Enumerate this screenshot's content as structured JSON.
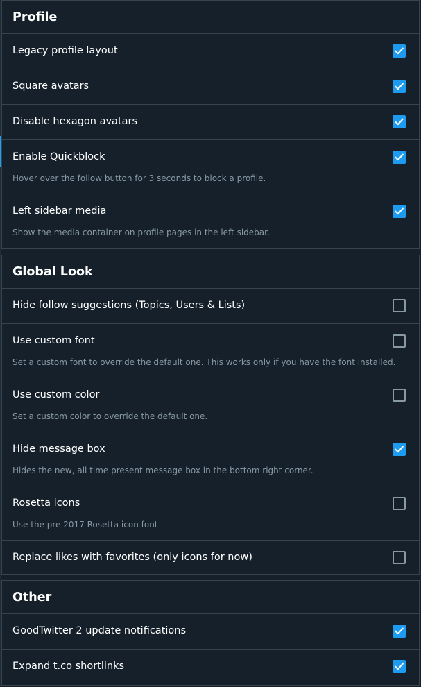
{
  "accent_color": "#1d9bf0",
  "sections": {
    "profile": {
      "title": "Profile",
      "items": [
        {
          "label": "Legacy profile layout",
          "description": "",
          "checked": true
        },
        {
          "label": "Square avatars",
          "description": "",
          "checked": true
        },
        {
          "label": "Disable hexagon avatars",
          "description": "",
          "checked": true
        },
        {
          "label": "Enable Quickblock",
          "description": "Hover over the follow button for 3 seconds to block a profile.",
          "checked": true
        },
        {
          "label": "Left sidebar media",
          "description": "Show the media container on profile pages in the left sidebar.",
          "checked": true
        }
      ]
    },
    "global_look": {
      "title": "Global Look",
      "items": [
        {
          "label": "Hide follow suggestions (Topics, Users & Lists)",
          "description": "",
          "checked": false
        },
        {
          "label": "Use custom font",
          "description": "Set a custom font to override the default one. This works only if you have the font installed.",
          "checked": false
        },
        {
          "label": "Use custom color",
          "description": "Set a custom color to override the default one.",
          "checked": false
        },
        {
          "label": "Hide message box",
          "description": "Hides the new, all time present message box in the bottom right corner.",
          "checked": true
        },
        {
          "label": "Rosetta icons",
          "description": "Use the pre 2017 Rosetta icon font",
          "checked": false
        },
        {
          "label": "Replace likes with favorites (only icons for now)",
          "description": "",
          "checked": false
        }
      ]
    },
    "other": {
      "title": "Other",
      "items": [
        {
          "label": "GoodTwitter 2 update notifications",
          "description": "",
          "checked": true
        },
        {
          "label": "Expand t.co shortlinks",
          "description": "",
          "checked": true
        }
      ]
    }
  }
}
